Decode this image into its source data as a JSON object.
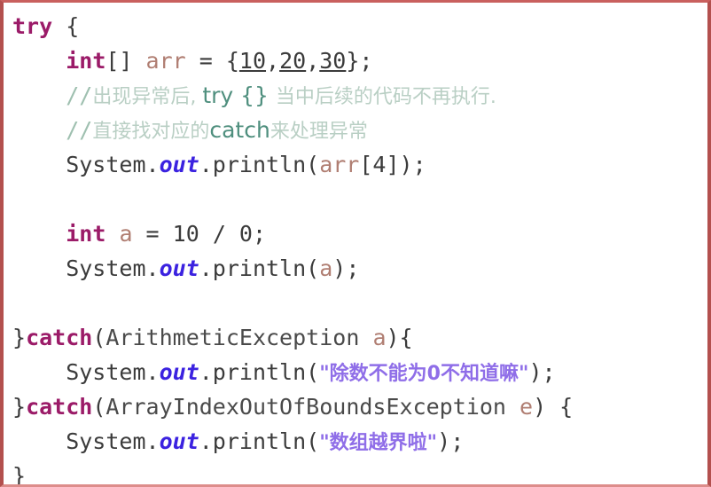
{
  "window": {
    "title": "Java try-catch code snippet",
    "border_color": "#b3504e",
    "background_color": "#ffffff"
  },
  "colors": {
    "keyword": "#9b1b68",
    "identifier": "#b07e72",
    "static_field": "#3b22e0",
    "string": "#8f6ee8",
    "comment": "#9fc0b0",
    "comment_code": "#4f8f7e",
    "plain_text": "#3b3b3b",
    "border": "#b3504e"
  },
  "code": {
    "language": "Java",
    "full_text": "try {\n    int[] arr = {10,20,30};\n    //出现异常后, try {} 当中后续的代码不再执行.\n    //直接找对应的catch来处理异常\n    System.out.println(arr[4]);\n\n    int a = 10 / 0;\n    System.out.println(a);\n\n}catch(ArithmeticException a){\n    System.out.println(\"除数不能为0不知道嘛\");\n}catch(ArrayIndexOutOfBoundsException e) {\n    System.out.println(\"数组越界啦\");\n}",
    "lines": [
      {
        "n": 1,
        "tokens": [
          {
            "t": "try",
            "c": "kw"
          },
          {
            "t": " {",
            "c": "plain"
          }
        ]
      },
      {
        "n": 2,
        "tokens": [
          {
            "t": "    ",
            "c": "plain"
          },
          {
            "t": "int",
            "c": "kw"
          },
          {
            "t": "[] ",
            "c": "plain"
          },
          {
            "t": "arr",
            "c": "ident"
          },
          {
            "t": " = {",
            "c": "plain"
          },
          {
            "t": "10",
            "c": "num"
          },
          {
            "t": ",",
            "c": "plain"
          },
          {
            "t": "20",
            "c": "num"
          },
          {
            "t": ",",
            "c": "plain"
          },
          {
            "t": "30",
            "c": "num"
          },
          {
            "t": "};",
            "c": "plain"
          }
        ]
      },
      {
        "n": 3,
        "tokens": [
          {
            "t": "    ",
            "c": "plain"
          },
          {
            "t": "//",
            "c": "cmt"
          },
          {
            "t": "出现异常后, ",
            "c": "cmt-cjk"
          },
          {
            "t": "try {} ",
            "c": "cmt-code"
          },
          {
            "t": "当中后续的代码不再执行.",
            "c": "cmt-cjk"
          }
        ]
      },
      {
        "n": 4,
        "tokens": [
          {
            "t": "    ",
            "c": "plain"
          },
          {
            "t": "//",
            "c": "cmt"
          },
          {
            "t": "直接找对应的",
            "c": "cmt-cjk"
          },
          {
            "t": "catch",
            "c": "cmt-code"
          },
          {
            "t": "来处理异常",
            "c": "cmt-cjk"
          }
        ]
      },
      {
        "n": 5,
        "tokens": [
          {
            "t": "    System.",
            "c": "plain"
          },
          {
            "t": "out",
            "c": "field"
          },
          {
            "t": ".println(",
            "c": "plain"
          },
          {
            "t": "arr",
            "c": "ident"
          },
          {
            "t": "[",
            "c": "plain"
          },
          {
            "t": "4",
            "c": "numplain"
          },
          {
            "t": "]);",
            "c": "plain"
          }
        ]
      },
      {
        "n": 6,
        "tokens": []
      },
      {
        "n": 7,
        "tokens": [
          {
            "t": "    ",
            "c": "plain"
          },
          {
            "t": "int",
            "c": "kw"
          },
          {
            "t": " ",
            "c": "plain"
          },
          {
            "t": "a",
            "c": "ident"
          },
          {
            "t": " = ",
            "c": "plain"
          },
          {
            "t": "10",
            "c": "numplain"
          },
          {
            "t": " / ",
            "c": "plain"
          },
          {
            "t": "0",
            "c": "numplain"
          },
          {
            "t": ";",
            "c": "plain"
          }
        ]
      },
      {
        "n": 8,
        "tokens": [
          {
            "t": "    System.",
            "c": "plain"
          },
          {
            "t": "out",
            "c": "field"
          },
          {
            "t": ".println(",
            "c": "plain"
          },
          {
            "t": "a",
            "c": "ident"
          },
          {
            "t": ");",
            "c": "plain"
          }
        ]
      },
      {
        "n": 9,
        "tokens": []
      },
      {
        "n": 10,
        "tokens": [
          {
            "t": "}",
            "c": "plain"
          },
          {
            "t": "catch",
            "c": "kw"
          },
          {
            "t": "(",
            "c": "plain"
          },
          {
            "t": "ArithmeticException",
            "c": "type"
          },
          {
            "t": " ",
            "c": "plain"
          },
          {
            "t": "a",
            "c": "ident"
          },
          {
            "t": "){",
            "c": "plain"
          }
        ]
      },
      {
        "n": 11,
        "tokens": [
          {
            "t": "    System.",
            "c": "plain"
          },
          {
            "t": "out",
            "c": "field"
          },
          {
            "t": ".println(",
            "c": "plain"
          },
          {
            "t": "\"除数不能为0不知道嘛\"",
            "c": "str"
          },
          {
            "t": ");",
            "c": "plain"
          }
        ]
      },
      {
        "n": 12,
        "tokens": [
          {
            "t": "}",
            "c": "plain"
          },
          {
            "t": "catch",
            "c": "kw"
          },
          {
            "t": "(",
            "c": "plain"
          },
          {
            "t": "ArrayIndexOutOfBoundsException",
            "c": "type"
          },
          {
            "t": " ",
            "c": "plain"
          },
          {
            "t": "e",
            "c": "ident"
          },
          {
            "t": ") {",
            "c": "plain"
          }
        ]
      },
      {
        "n": 13,
        "tokens": [
          {
            "t": "    System.",
            "c": "plain"
          },
          {
            "t": "out",
            "c": "field"
          },
          {
            "t": ".println(",
            "c": "plain"
          },
          {
            "t": "\"数组越界啦\"",
            "c": "str"
          },
          {
            "t": ");",
            "c": "plain"
          }
        ]
      },
      {
        "n": 14,
        "tokens": [
          {
            "t": "}",
            "c": "plain"
          }
        ]
      }
    ]
  }
}
